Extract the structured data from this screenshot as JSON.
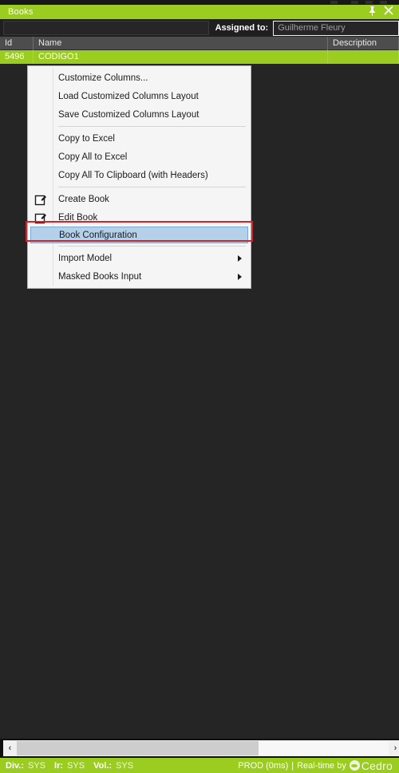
{
  "window": {
    "title": "Books",
    "pin_icon": "pin-icon",
    "close_icon": "close-icon"
  },
  "toolbar": {
    "filter_value": "",
    "filter_placeholder": "",
    "assigned_label": "Assigned to:",
    "assigned_value": "Guilherme Fleury",
    "dropdown_icon": "chevron-down-icon"
  },
  "grid": {
    "columns": [
      "Id",
      "Name",
      "Description"
    ],
    "rows": [
      {
        "id": "5496",
        "name": "CODIGO1",
        "description": ""
      }
    ]
  },
  "context_menu": {
    "items": [
      {
        "label": "Customize Columns...",
        "icon": "",
        "submenu": false,
        "separator_after": false,
        "highlighted": false
      },
      {
        "label": "Load Customized Columns Layout",
        "icon": "",
        "submenu": false,
        "separator_after": false,
        "highlighted": false
      },
      {
        "label": "Save Customized Columns Layout",
        "icon": "",
        "submenu": false,
        "separator_after": true,
        "highlighted": false
      },
      {
        "label": "Copy to Excel",
        "icon": "",
        "submenu": false,
        "separator_after": false,
        "highlighted": false
      },
      {
        "label": "Copy All to Excel",
        "icon": "",
        "submenu": false,
        "separator_after": false,
        "highlighted": false
      },
      {
        "label": "Copy All To Clipboard (with Headers)",
        "icon": "",
        "submenu": false,
        "separator_after": true,
        "highlighted": false
      },
      {
        "label": "Create Book",
        "icon": "edit-pencil-icon",
        "submenu": false,
        "separator_after": false,
        "highlighted": false
      },
      {
        "label": "Edit Book",
        "icon": "edit-pencil-icon",
        "submenu": false,
        "separator_after": false,
        "highlighted": false
      },
      {
        "label": "Book Configuration",
        "icon": "",
        "submenu": false,
        "separator_after": true,
        "highlighted": true
      },
      {
        "label": "Import Model",
        "icon": "",
        "submenu": true,
        "separator_after": false,
        "highlighted": false
      },
      {
        "label": "Masked Books Input",
        "icon": "",
        "submenu": true,
        "separator_after": false,
        "highlighted": false
      }
    ]
  },
  "scrollbar": {
    "left_arrow": "‹",
    "right_arrow": "›"
  },
  "statusbar": {
    "fields": [
      {
        "key": "Div.:",
        "value": "SYS"
      },
      {
        "key": "Ir:",
        "value": "SYS"
      },
      {
        "key": "Vol.:",
        "value": "SYS"
      }
    ],
    "environment": "PROD (0ms)",
    "separator": "|",
    "realtime_text": "Real-time by",
    "brand": "Cedro"
  },
  "colors": {
    "accent_green": "#9ACD1F",
    "highlight_blue": "#b5d1ea",
    "focus_red": "#d6212b",
    "panel_dark": "#252526"
  }
}
